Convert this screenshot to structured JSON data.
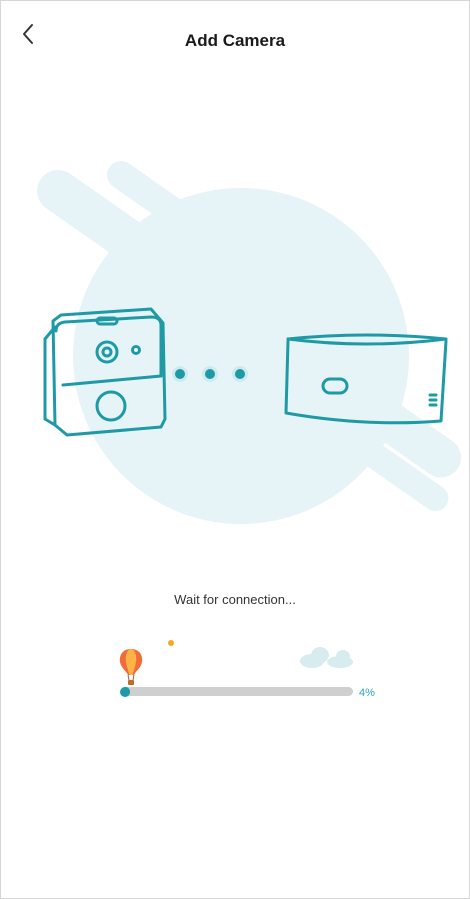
{
  "header": {
    "title": "Add Camera",
    "back_icon": "chevron-left-icon"
  },
  "status": {
    "text": "Wait for connection..."
  },
  "progress": {
    "value_percent": 4,
    "label": "4%"
  },
  "colors": {
    "accent": "#29a9b4",
    "outline": "#1e9aa6",
    "backdrop": "#e6f3f7",
    "track": "#cfcfcf",
    "balloon": "#f26b3a"
  }
}
